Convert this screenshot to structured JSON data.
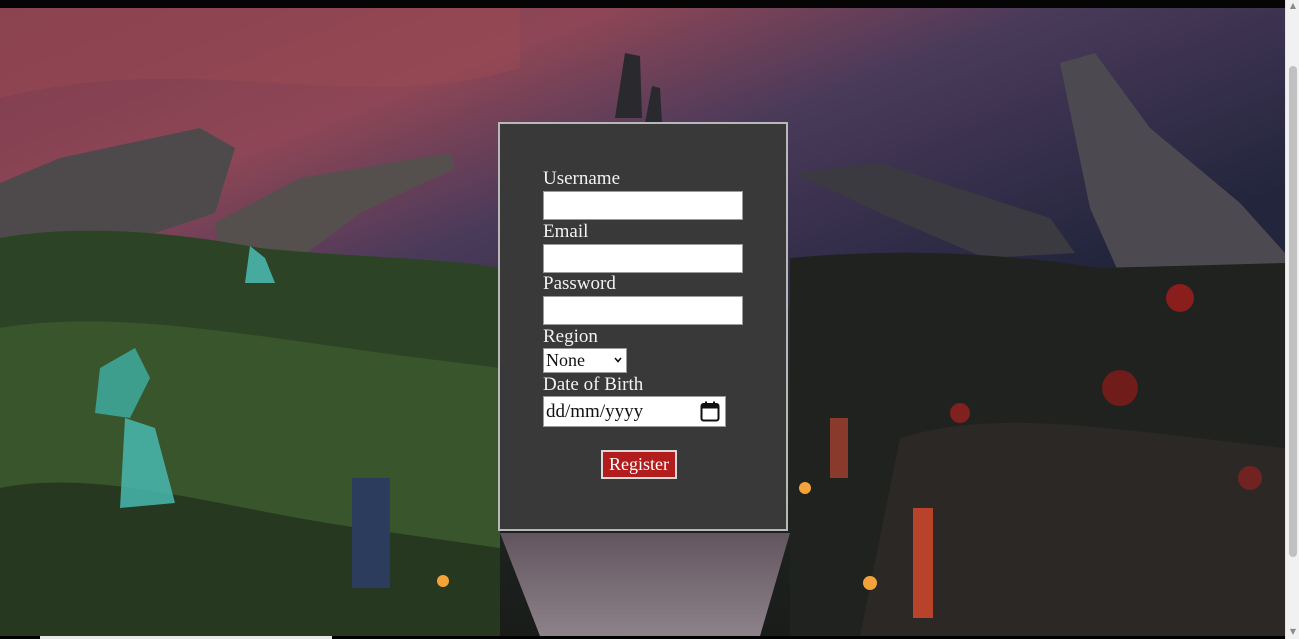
{
  "form": {
    "username_label": "Username",
    "email_label": "Email",
    "password_label": "Password",
    "region_label": "Region",
    "region_selected": "None",
    "dob_label": "Date of Birth",
    "dob_placeholder": "dd/mm/yyyy",
    "register_label": "Register"
  },
  "icons": {
    "calendar": "calendar-icon",
    "select_arrow": "chevron-down-icon",
    "scroll_up": "scroll-up-arrow",
    "scroll_down": "scroll-down-arrow"
  },
  "colors": {
    "panel_background": "#393939",
    "panel_border": "#b8b8b8",
    "button_background": "#b31c1c",
    "label_text": "#f2f2f2"
  }
}
